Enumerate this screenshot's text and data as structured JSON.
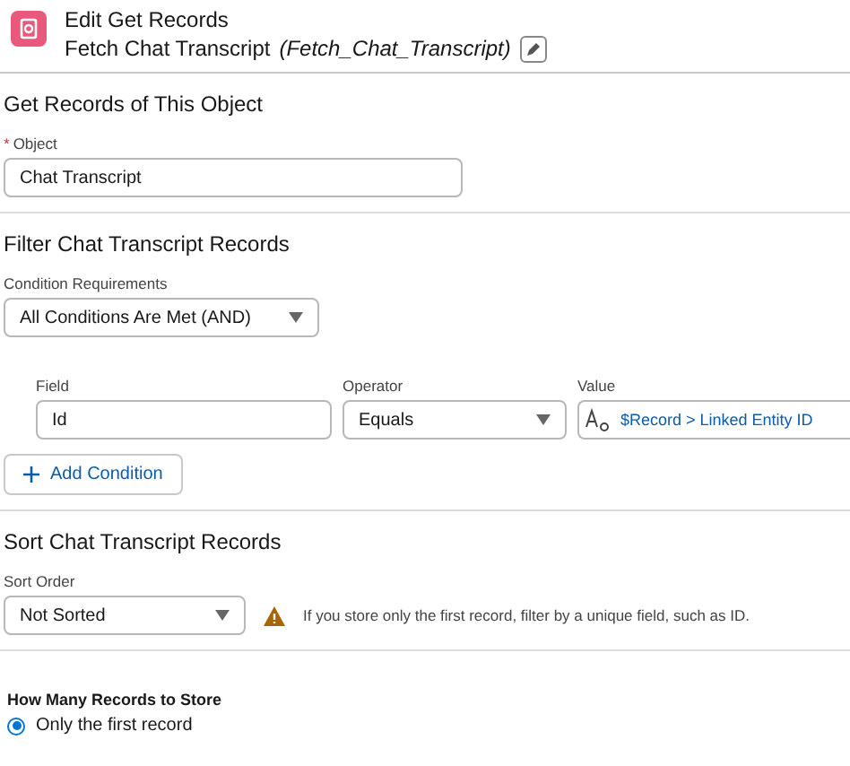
{
  "header": {
    "title": "Edit Get Records",
    "subtitle": "Fetch Chat Transcript",
    "api_name": "(Fetch_Chat_Transcript)"
  },
  "object_section": {
    "title": "Get Records of This Object",
    "field": {
      "label": "Object",
      "required_mark": "*",
      "value": "Chat Transcript"
    }
  },
  "filter_section": {
    "title": "Filter Chat Transcript Records",
    "condition_requirements": {
      "label": "Condition Requirements",
      "value": "All Conditions Are Met (AND)"
    },
    "condition_columns": [
      "Field",
      "Operator",
      "Value"
    ],
    "conditions": [
      {
        "field": "Id",
        "operator": "Equals",
        "value": "$Record > Linked Entity ID"
      }
    ],
    "add_button": "Add Condition"
  },
  "sort_section": {
    "title": "Sort Chat Transcript Records",
    "sort_order": {
      "label": "Sort Order",
      "value": "Not Sorted"
    },
    "warning": "If you store only the first record, filter by a unique field, such as ID."
  },
  "store_section": {
    "title": "How Many Records to Store",
    "options": [
      {
        "label": "Only the first record",
        "selected": true
      }
    ]
  }
}
